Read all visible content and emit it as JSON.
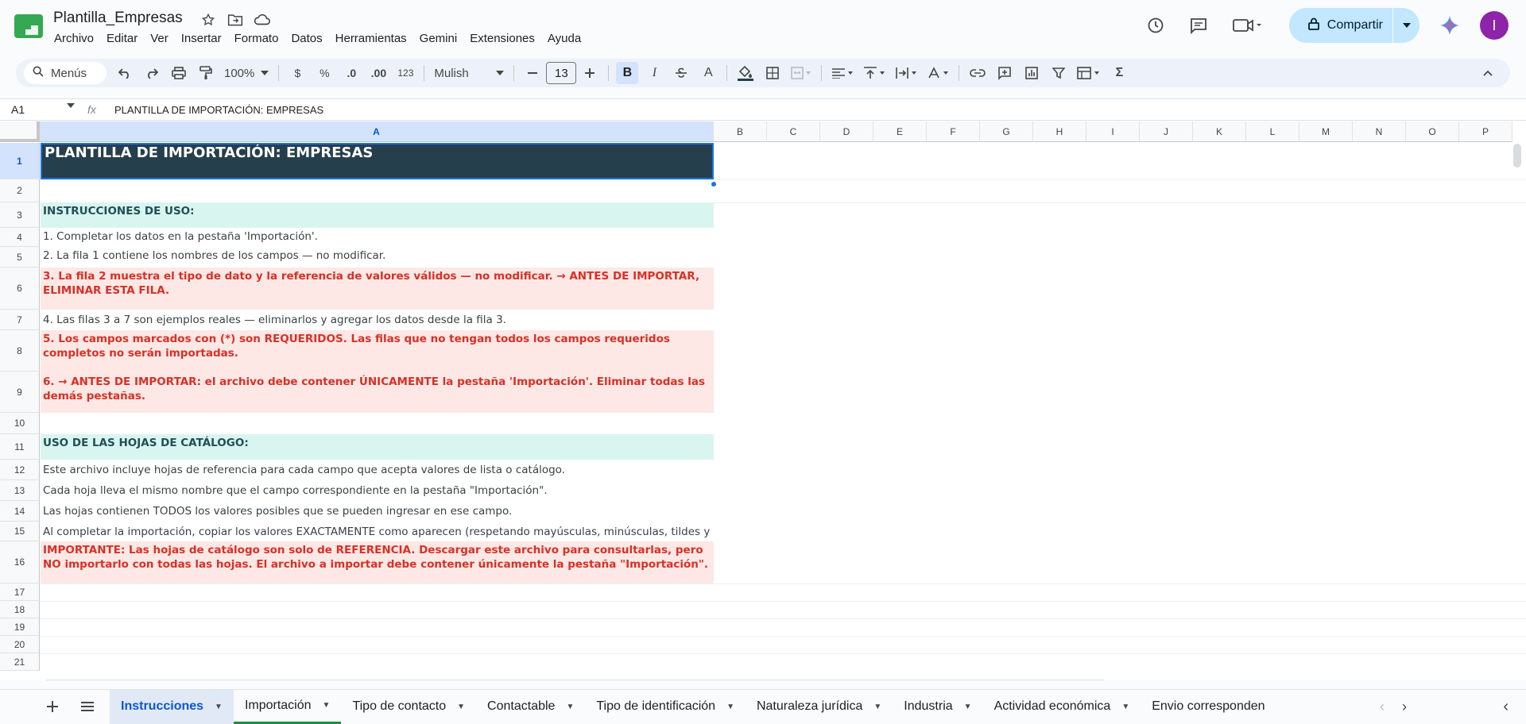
{
  "app": {
    "title": "Plantilla_Empresas",
    "avatar_letter": "I",
    "share_label": "Compartir",
    "menus": [
      "Archivo",
      "Editar",
      "Ver",
      "Insertar",
      "Formato",
      "Datos",
      "Herramientas",
      "Gemini",
      "Extensiones",
      "Ayuda"
    ]
  },
  "toolbar": {
    "search_label": "Menús",
    "zoom": "100%",
    "currency": "$",
    "percent": "%",
    "dec_less": ".0",
    "dec_more": ".00",
    "number_format": "123",
    "font": "Mulish",
    "font_size": "13",
    "bold": "B",
    "italic": "I",
    "text_color": "A",
    "sum": "Σ"
  },
  "formula_bar": {
    "cell_ref": "A1",
    "fx": "fx",
    "content": "PLANTILLA DE IMPORTACIÓN: EMPRESAS"
  },
  "columns": [
    "A",
    "B",
    "C",
    "D",
    "E",
    "F",
    "G",
    "H",
    "I",
    "J",
    "K",
    "L",
    "M",
    "N",
    "O",
    "P"
  ],
  "rows": [
    "1",
    "2",
    "3",
    "4",
    "5",
    "6",
    "7",
    "8",
    "9",
    "10",
    "11",
    "12",
    "13",
    "14",
    "15",
    "16",
    "17",
    "18",
    "19",
    "20",
    "21"
  ],
  "cells": {
    "r1": "PLANTILLA DE IMPORTACIÓN: EMPRESAS",
    "r3": "INSTRUCCIONES DE USO:",
    "r4": "1. Completar los datos en la pestaña 'Importación'.",
    "r5": "2. La fila 1 contiene los nombres de los campos — no modificar.",
    "r6": "3. La fila 2 muestra el tipo de dato y la referencia de valores válidos — no modificar. → ANTES DE IMPORTAR, ELIMINAR ESTA FILA.",
    "r7": "4. Las filas 3 a 7 son ejemplos reales — eliminarlos y agregar los datos desde la fila 3.",
    "r8": "5. Los campos marcados con (*) son REQUERIDOS. Las filas que no tengan todos los campos requeridos completos no serán importadas.",
    "r9": "6. → ANTES DE IMPORTAR: el archivo debe contener ÚNICAMENTE la pestaña 'Importación'. Eliminar todas las demás pestañas.",
    "r11": "USO DE LAS HOJAS DE CATÁLOGO:",
    "r12": "Este archivo incluye hojas de referencia para cada campo que acepta valores de lista o catálogo.",
    "r13": "Cada hoja lleva el mismo nombre que el campo correspondiente en la pestaña \"Importación\".",
    "r14": "Las hojas contienen TODOS los valores posibles que se pueden ingresar en ese campo.",
    "r15": "Al completar la importación, copiar los valores EXACTAMENTE como aparecen (respetando mayúsculas, minúsculas, tildes y",
    "r16": "IMPORTANTE: Las hojas de catálogo son solo de REFERENCIA. Descargar este archivo para consultarlas, pero NO importarlo con todas las hojas. El archivo a importar debe contener únicamente la pestaña \"Importación\"."
  },
  "sheets": [
    "Instrucciones",
    "Importación",
    "Tipo de contacto",
    "Contactable",
    "Tipo de identificación",
    "Naturaleza jurídica",
    "Industria",
    "Actividad económica",
    "Envio corresponden"
  ],
  "colors": {
    "title_bg": "#263f4c",
    "teal_bg": "#d9f5ef",
    "pink_bg": "#fde8e6",
    "red_text": "#d93025",
    "accent": "#0b57d0"
  }
}
